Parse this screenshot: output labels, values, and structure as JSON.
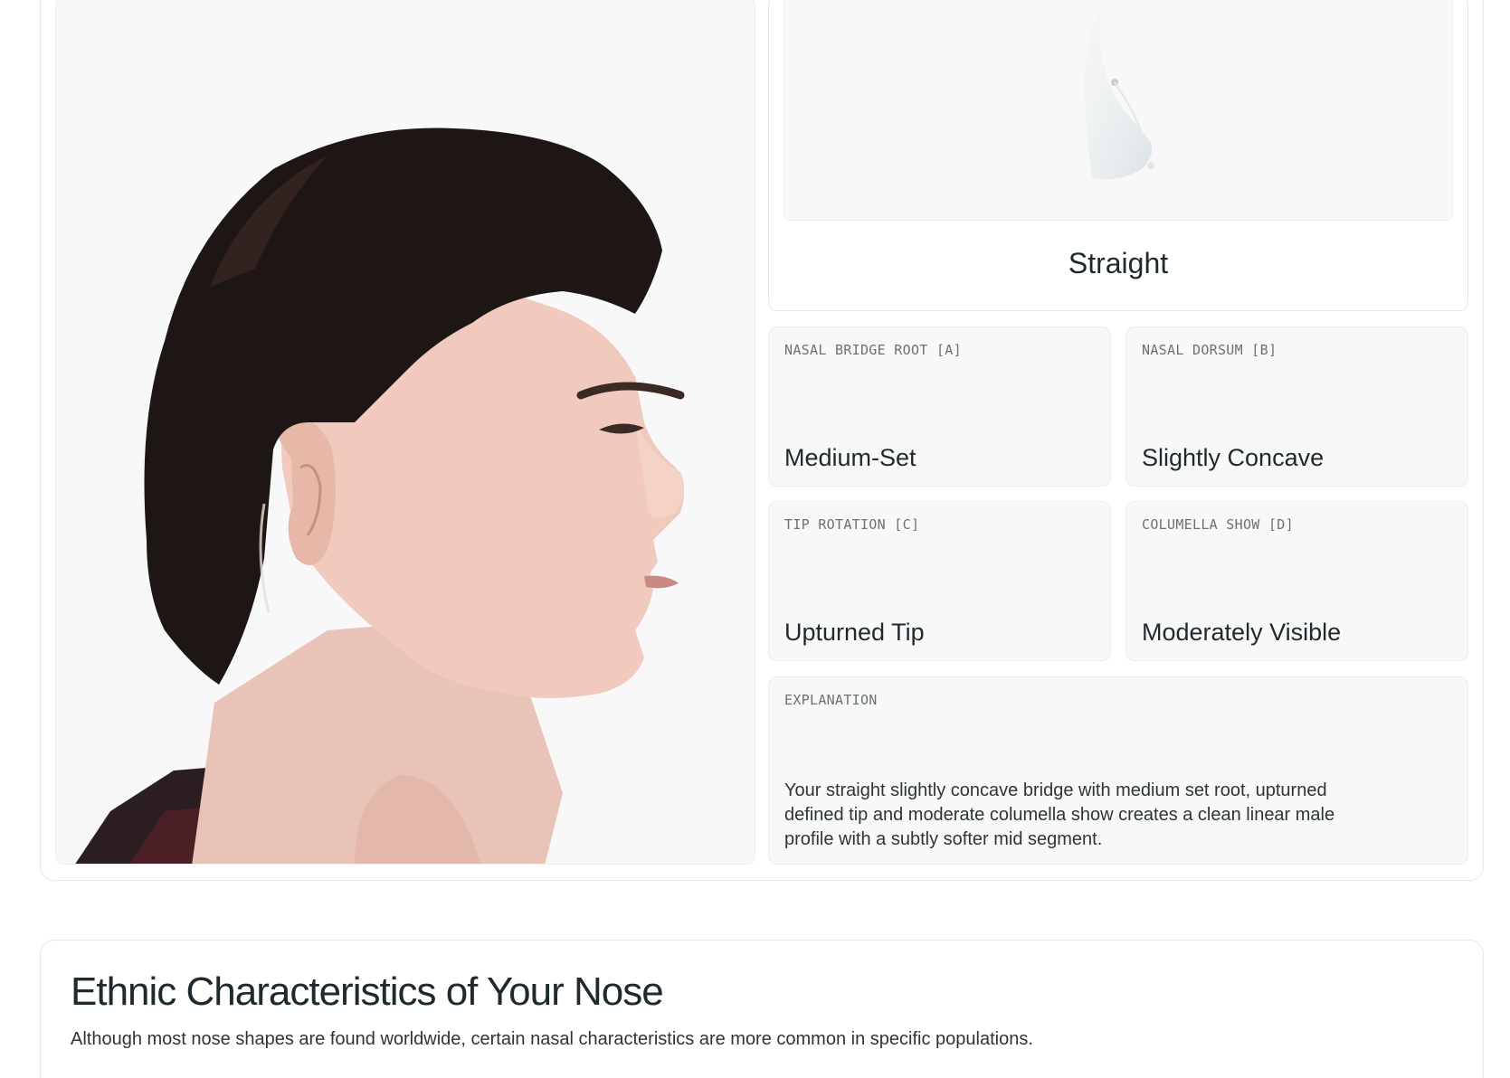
{
  "nose_shape": {
    "label": "Straight"
  },
  "attributes": [
    {
      "key": "NASAL BRIDGE ROOT [A]",
      "value": "Medium-Set"
    },
    {
      "key": "NASAL DORSUM [B]",
      "value": "Slightly Concave"
    },
    {
      "key": "TIP ROTATION [C]",
      "value": "Upturned Tip"
    },
    {
      "key": "COLUMELLA SHOW [D]",
      "value": "Moderately Visible"
    }
  ],
  "explanation": {
    "key": "EXPLANATION",
    "text": "Your straight slightly concave bridge with medium set root, upturned defined tip and moderate columella show creates a clean linear male profile with a subtly softer mid segment."
  },
  "ethnic_section": {
    "title": "Ethnic Characteristics of Your Nose",
    "subtitle": "Although most nose shapes are found worldwide, certain nasal characteristics are more common in specific populations."
  },
  "colors": {
    "card_background": "#f8f8f8",
    "border": "#e7e9ea",
    "text": "#1f2a2e",
    "muted": "#6b7276"
  }
}
